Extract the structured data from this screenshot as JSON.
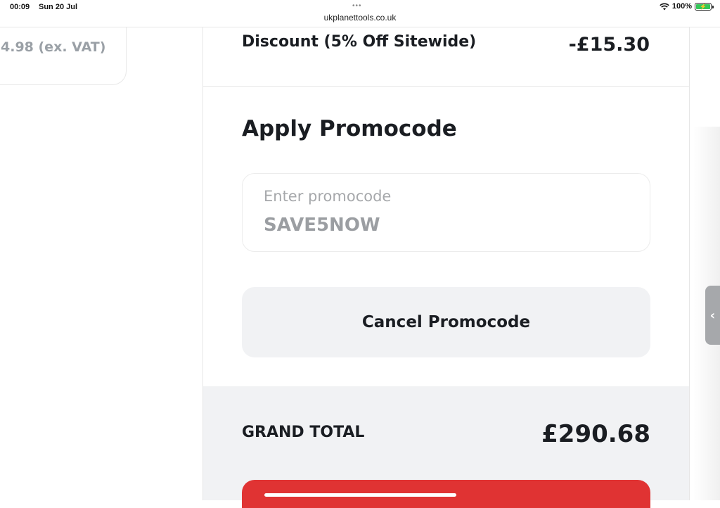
{
  "status_bar": {
    "time": "00:09",
    "date": "Sun 20 Jul",
    "url": "ukplanettools.co.uk",
    "battery": "100%"
  },
  "left_card": {
    "price_fragment": "4.98 (ex. VAT)"
  },
  "summary": {
    "discount_label": "Discount (5% Off Sitewide)",
    "discount_value": "-£15.30"
  },
  "promo": {
    "title": "Apply Promocode",
    "input_placeholder": "Enter promocode",
    "input_value": "SAVE5NOW",
    "cancel_label": "Cancel Promocode"
  },
  "totals": {
    "grand_total_label": "GRAND TOTAL",
    "grand_total_value": "£290.68"
  },
  "side_handle_icon": "chevron-left-icon",
  "colors": {
    "accent_red": "#e03333",
    "panel_grey": "#f1f2f4",
    "text_dark": "#1a1d22",
    "muted_text": "#9b9ea2"
  }
}
